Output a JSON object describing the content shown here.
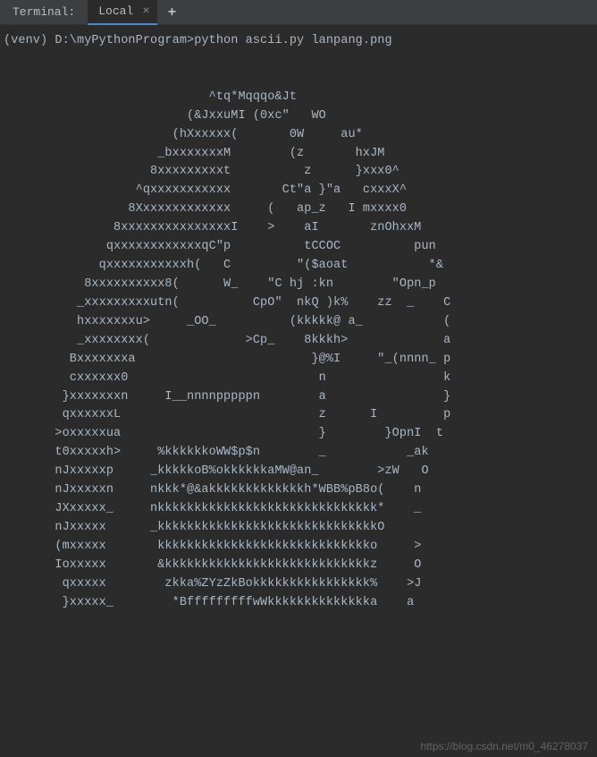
{
  "tabBar": {
    "terminalLabel": "Terminal:",
    "activeTab": "Local",
    "closeGlyph": "×",
    "addGlyph": "+"
  },
  "terminal": {
    "prompt": "(venv) D:\\myPythonProgram>python ascii.py lanpang.png",
    "output": "\n\n\n                            ^tq*Mqqqo&Jt\n                         (&JxxuMI (0xc\"   WO\n                       (hXxxxxx(       0W     au*\n                     _bxxxxxxxM        (z       hxJM\n                    8xxxxxxxxxt          z      }xxx0^\n                  ^qxxxxxxxxxxx       Ct\"a }\"a   cxxxX^\n                 8Xxxxxxxxxxxxx     (   ap_z   I mxxxx0\n               8xxxxxxxxxxxxxxxI    >    aI       znOhxxM\n              qxxxxxxxxxxxxqC\"p          tCCOC          pun\n             qxxxxxxxxxxxh(   C         \"($aoat           *&\n           8xxxxxxxxxx8(      W_    \"C hj :kn        \"Opn_p\n          _xxxxxxxxxutn(          CpO\"  nkQ )k%    zz  _    C\n          hxxxxxxxu>     _OO_          (kkkkk@ a_           (\n          _xxxxxxxx(             >Cp_    8kkkh>             a\n         Bxxxxxxxa                        }@%I     \"_(nnnn_ p\n         cxxxxxx0                          n                k\n        }xxxxxxxn     I__nnnnpppppn        a                }\n        qxxxxxxL                           z      I         p\n       >oxxxxxua                           }        }OpnI  t\n       t0xxxxxh>     %kkkkkkoWW$p$n        _           _ak\n       nJxxxxxp     _kkkkkoB%okkkkkkaMW@an_        >zW   O\n       nJxxxxxn     nkkk*@&akkkkkkkkkkkkkh*WBB%pB8o(    n\n       JXxxxxx_     nkkkkkkkkkkkkkkkkkkkkkkkkkkkkkk*    _\n       nJxxxxx      _kkkkkkkkkkkkkkkkkkkkkkkkkkkkkkO\n       (mxxxxx       kkkkkkkkkkkkkkkkkkkkkkkkkkkkko     >\n       Ioxxxxx       &kkkkkkkkkkkkkkkkkkkkkkkkkkkkz     O\n        qxxxxx        zkka%ZYzZkBokkkkkkkkkkkkkkkk%    >J\n        }xxxxx_        *BfffffffffwWkkkkkkkkkkkkkka    a"
  },
  "watermark": "https://blog.csdn.net/m0_46278037"
}
